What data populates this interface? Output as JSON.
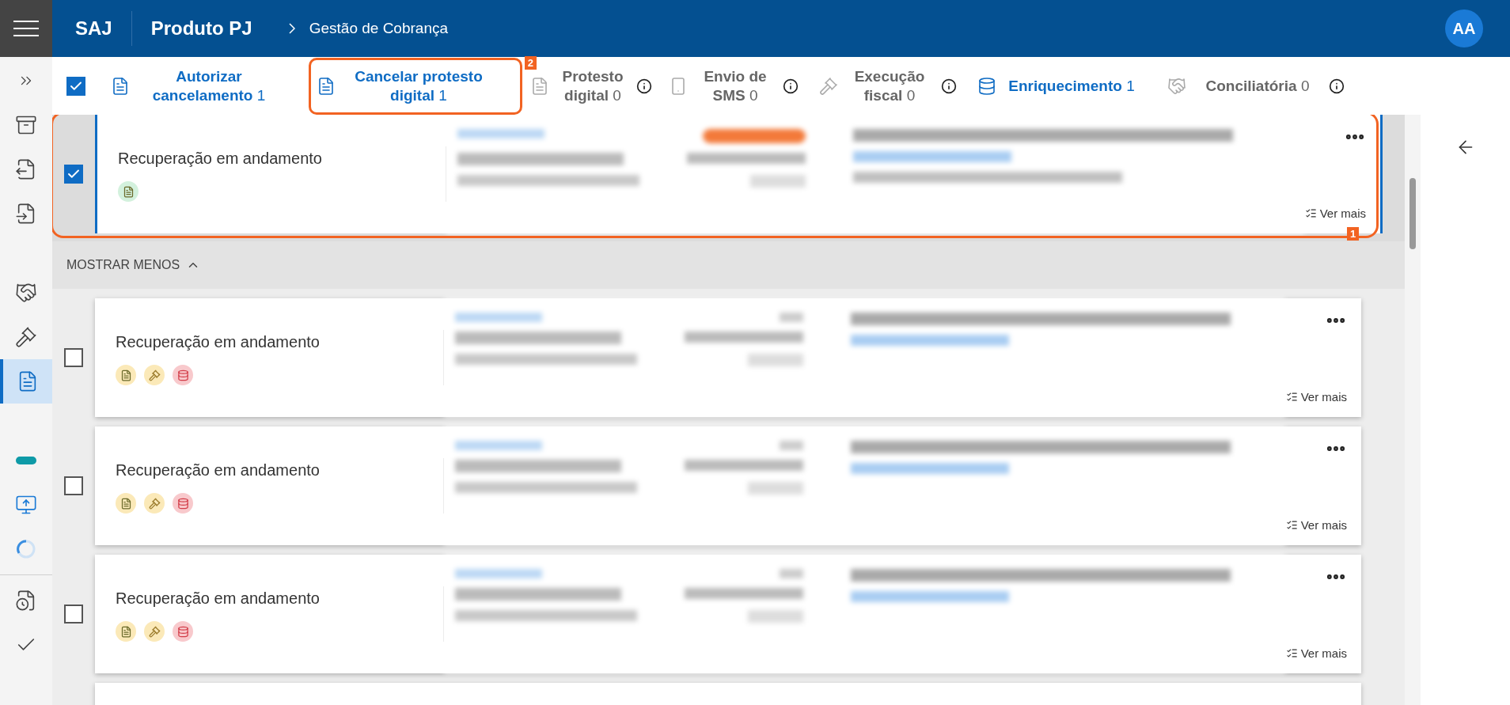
{
  "header": {
    "brand": "SAJ",
    "product": "Produto PJ",
    "breadcrumb": "Gestão de Cobrança",
    "avatar": "AA"
  },
  "sidebar": {
    "groups": [
      {
        "kind": "plain",
        "items": [
          {
            "kind": "expand",
            "selected": false
          },
          {
            "kind": "archive",
            "selected": false
          },
          {
            "kind": "money-out",
            "selected": false
          },
          {
            "kind": "money-in",
            "selected": false
          }
        ]
      },
      {
        "kind": "spaced",
        "items": [
          {
            "kind": "handshake",
            "selected": false
          },
          {
            "kind": "gavel",
            "selected": false
          },
          {
            "kind": "document",
            "selected": true
          }
        ]
      },
      {
        "kind": "spaced",
        "items": [
          {
            "kind": "bar",
            "selected": false
          },
          {
            "kind": "screen-add",
            "selected": false
          },
          {
            "kind": "spinner",
            "selected": false
          }
        ]
      },
      {
        "kind": "divided",
        "items": [
          {
            "kind": "money-clock",
            "selected": false
          },
          {
            "kind": "check",
            "selected": false
          }
        ]
      }
    ]
  },
  "toolbar": {
    "select_all_checked": true,
    "actions": [
      {
        "kind": "document",
        "label": "Autorizar cancelamento",
        "count": "1",
        "enabled": true,
        "info": false
      },
      {
        "kind": "document",
        "label": "Cancelar protesto digital",
        "count": "1",
        "enabled": true,
        "info": false,
        "annotation": "2"
      },
      {
        "kind": "document",
        "label": "Protesto digital",
        "count": "0",
        "enabled": false,
        "info": true
      },
      {
        "kind": "phone",
        "label": "Envio de SMS",
        "count": "0",
        "enabled": false,
        "info": true
      },
      {
        "kind": "gavel",
        "label": "Execução fiscal",
        "count": "0",
        "enabled": false,
        "info": true
      },
      {
        "kind": "database",
        "label": "Enriquecimento",
        "count": "1",
        "enabled": true,
        "info": false
      },
      {
        "kind": "handshake",
        "label": "Conciliatória",
        "count": "0",
        "enabled": false,
        "info": true
      }
    ]
  },
  "list": {
    "toggle": "MOSTRAR MENOS",
    "cards": [
      {
        "status": "Recuperação em andamento",
        "checked": true,
        "selected": true,
        "more": "Ver mais",
        "annotation": "1",
        "badges": [
          {
            "kind": "document",
            "color": "#d3f1dd"
          }
        ]
      },
      {
        "status": "Recuperação em andamento",
        "checked": false,
        "selected": false,
        "more": "Ver mais",
        "badges": [
          {
            "kind": "document",
            "color": "#fbe9b8"
          },
          {
            "kind": "gavel",
            "color": "#fbe9b8"
          },
          {
            "kind": "database",
            "color": "#f8c9cc"
          }
        ]
      },
      {
        "status": "Recuperação em andamento",
        "checked": false,
        "selected": false,
        "more": "Ver mais",
        "badges": [
          {
            "kind": "document",
            "color": "#fbe9b8"
          },
          {
            "kind": "gavel",
            "color": "#fbe9b8"
          },
          {
            "kind": "database",
            "color": "#f8c9cc"
          }
        ]
      },
      {
        "status": "Recuperação em andamento",
        "checked": false,
        "selected": false,
        "more": "Ver mais",
        "badges": [
          {
            "kind": "document",
            "color": "#fbe9b8"
          },
          {
            "kind": "gavel",
            "color": "#fbe9b8"
          },
          {
            "kind": "database",
            "color": "#f8c9cc"
          }
        ]
      }
    ]
  }
}
